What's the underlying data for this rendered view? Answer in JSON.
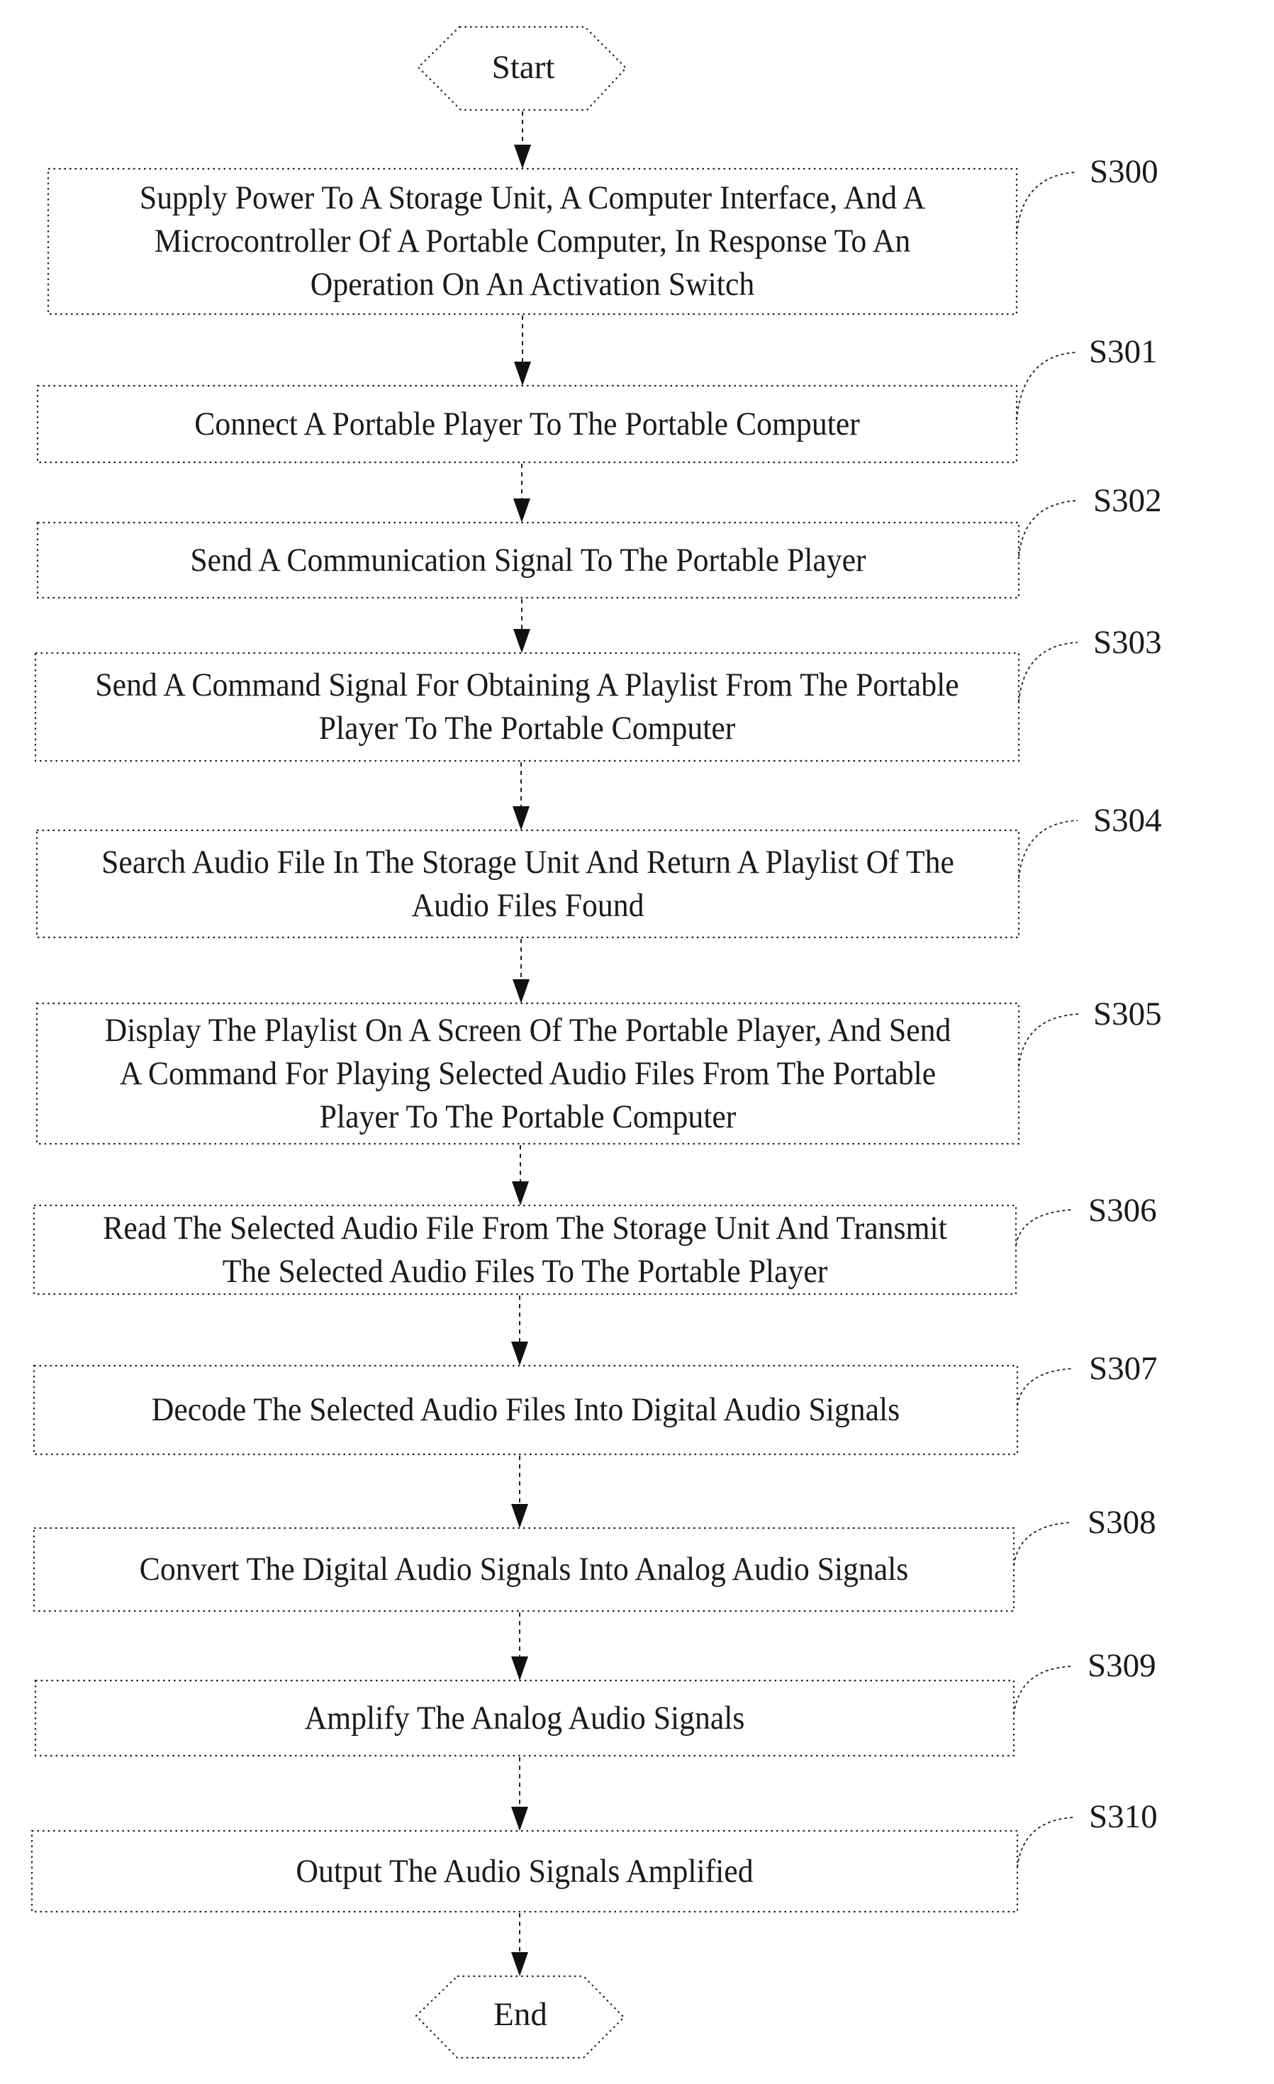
{
  "figure": {
    "start": {
      "label": "Start"
    },
    "end": {
      "label": "End"
    },
    "steps": [
      {
        "id": "S300",
        "text": "Supply Power To A Storage Unit, A Computer Interface, And A Microcontroller Of A Portable Computer, In Response To An Operation On An Activation Switch"
      },
      {
        "id": "S301",
        "text": "Connect A Portable Player To The Portable Computer"
      },
      {
        "id": "S302",
        "text": "Send A Communication Signal To The Portable Player"
      },
      {
        "id": "S303",
        "text": "Send A Command Signal For Obtaining A Playlist From The Portable Player To The Portable Computer"
      },
      {
        "id": "S304",
        "text": "Search Audio File In The Storage Unit And Return A Playlist Of The Audio Files Found"
      },
      {
        "id": "S305",
        "text": "Display The Playlist On A Screen Of The Portable Player, And Send A Command For Playing Selected Audio Files From The Portable Player To The Portable Computer"
      },
      {
        "id": "S306",
        "text": "Read The Selected Audio File From The Storage Unit And Transmit The Selected Audio Files To The Portable Player"
      },
      {
        "id": "S307",
        "text": "Decode The Selected Audio Files Into Digital Audio Signals"
      },
      {
        "id": "S308",
        "text": "Convert The Digital Audio Signals Into Analog Audio Signals"
      },
      {
        "id": "S309",
        "text": "Amplify The Analog Audio Signals"
      },
      {
        "id": "S310",
        "text": "Output The Audio Signals Amplified"
      }
    ]
  }
}
